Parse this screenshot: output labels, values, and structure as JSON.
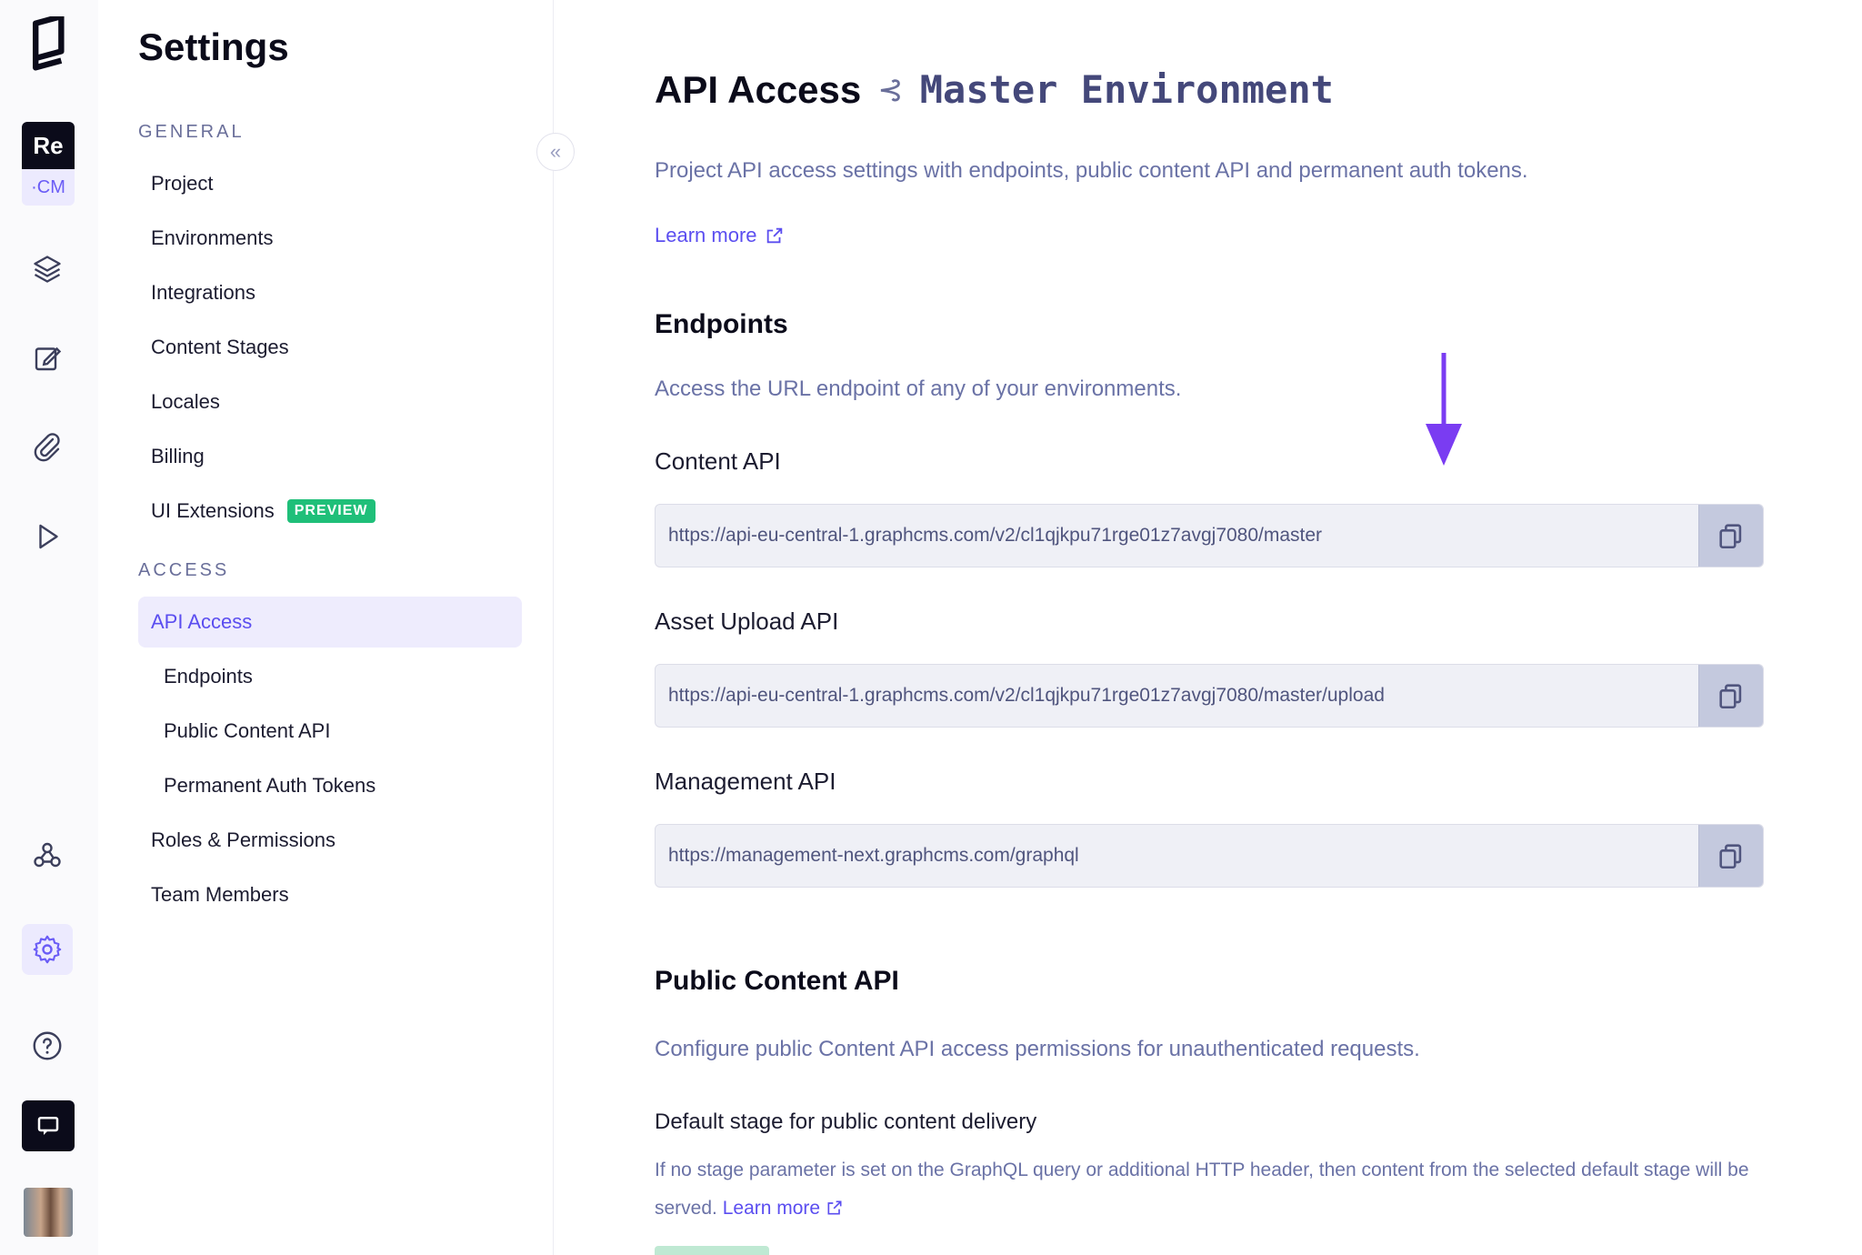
{
  "rail": {
    "project_initials": "Re",
    "env_short": "·CM",
    "items": [
      {
        "name": "schema-icon"
      },
      {
        "name": "content-edit-icon"
      },
      {
        "name": "assets-icon"
      },
      {
        "name": "playground-icon"
      },
      {
        "name": "webhooks-icon"
      },
      {
        "name": "settings-icon"
      },
      {
        "name": "help-icon"
      },
      {
        "name": "chat-icon"
      }
    ]
  },
  "sidebar": {
    "title": "Settings",
    "general_label": "GENERAL",
    "access_label": "ACCESS",
    "general_items": [
      {
        "label": "Project"
      },
      {
        "label": "Environments"
      },
      {
        "label": "Integrations"
      },
      {
        "label": "Content Stages"
      },
      {
        "label": "Locales"
      },
      {
        "label": "Billing"
      },
      {
        "label": "UI Extensions",
        "badge": "PREVIEW"
      }
    ],
    "access_items": [
      {
        "label": "API Access"
      },
      {
        "label": "Endpoints"
      },
      {
        "label": "Public Content API"
      },
      {
        "label": "Permanent Auth Tokens"
      },
      {
        "label": "Roles & Permissions"
      },
      {
        "label": "Team Members"
      }
    ],
    "collapse_glyph": "«"
  },
  "main": {
    "title": "API Access",
    "env_glyph": "⊰",
    "env_name": "Master Environment",
    "description": "Project API access settings with endpoints, public content API and permanent auth tokens.",
    "learn_more": "Learn more",
    "endpoints": {
      "heading": "Endpoints",
      "description": "Access the URL endpoint of any of your environments.",
      "fields": [
        {
          "label": "Content API",
          "value": "https://api-eu-central-1.graphcms.com/v2/cl1qjkpu71rge01z7avgj7080/master"
        },
        {
          "label": "Asset Upload API",
          "value": "https://api-eu-central-1.graphcms.com/v2/cl1qjkpu71rge01z7avgj7080/master/upload"
        },
        {
          "label": "Management API",
          "value": "https://management-next.graphcms.com/graphql"
        }
      ]
    },
    "public_api": {
      "heading": "Public Content API",
      "description": "Configure public Content API access permissions for unauthenticated requests.",
      "default_stage_label": "Default stage for public content delivery",
      "help_text": "If no stage parameter is set on the GraphQL query or additional HTTP header, then content from the selected default stage will be served.",
      "help_link": "Learn more"
    }
  },
  "colors": {
    "accent": "#5b4ef0",
    "annotation_arrow": "#7a3cf2",
    "preview_badge": "#1fbf79"
  }
}
